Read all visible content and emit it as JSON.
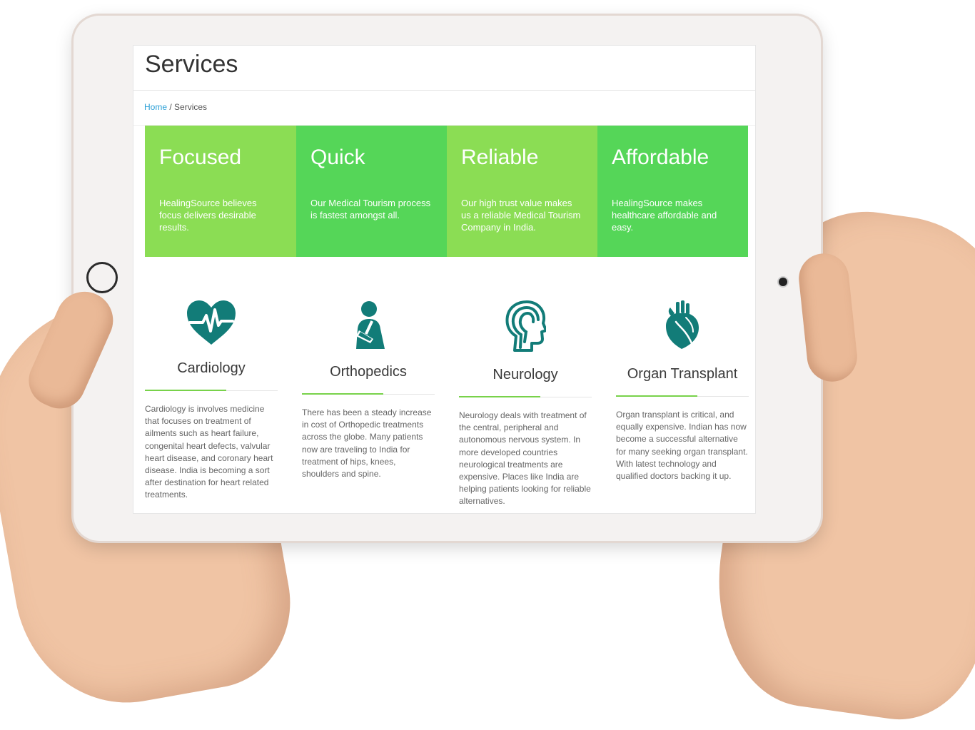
{
  "page": {
    "title": "Services",
    "breadcrumb": {
      "home": "Home",
      "separator": " / ",
      "current": "Services"
    }
  },
  "features": [
    {
      "title": "Focused",
      "text": "HealingSource believes focus delivers desirable results."
    },
    {
      "title": "Quick",
      "text": "Our Medical Tourism process is fastest amongst all."
    },
    {
      "title": "Reliable",
      "text": "Our high trust value makes us a reliable Medical Tourism Company in India."
    },
    {
      "title": "Affordable",
      "text": "HealingSource makes healthcare affordable and easy."
    }
  ],
  "services": [
    {
      "icon": "heart-pulse-icon",
      "title": "Cardiology",
      "text": "Cardiology is involves medicine that focuses on treatment of ailments such as heart failure, congenital heart defects, valvular heart disease, and coronary heart disease. India is becoming a sort after destination for heart related treatments."
    },
    {
      "icon": "orthopedic-patient-icon",
      "title": "Orthopedics",
      "text": "There has been a steady increase in cost of Orthopedic treatments across the globe. Many patients now are traveling to India for treatment of hips, knees, shoulders and spine."
    },
    {
      "icon": "head-brain-icon",
      "title": "Neurology",
      "text": "Neurology deals with treatment of the central, peripheral and autonomous nervous system. In more developed countries neurological treatments are expensive. Places like India are helping patients looking for reliable alternatives."
    },
    {
      "icon": "anatomical-heart-icon",
      "title": "Organ Transplant",
      "text": "Organ transplant is critical, and equally expensive. Indian has now become a successful alternative for many seeking organ transplant. With latest technology and qualified doctors backing it up."
    }
  ],
  "colors": {
    "feature_light": "#8bdd54",
    "feature_dark": "#55d658",
    "icon_teal": "#127c78",
    "accent_green": "#78d24a",
    "link_blue": "#2a9fd6"
  }
}
